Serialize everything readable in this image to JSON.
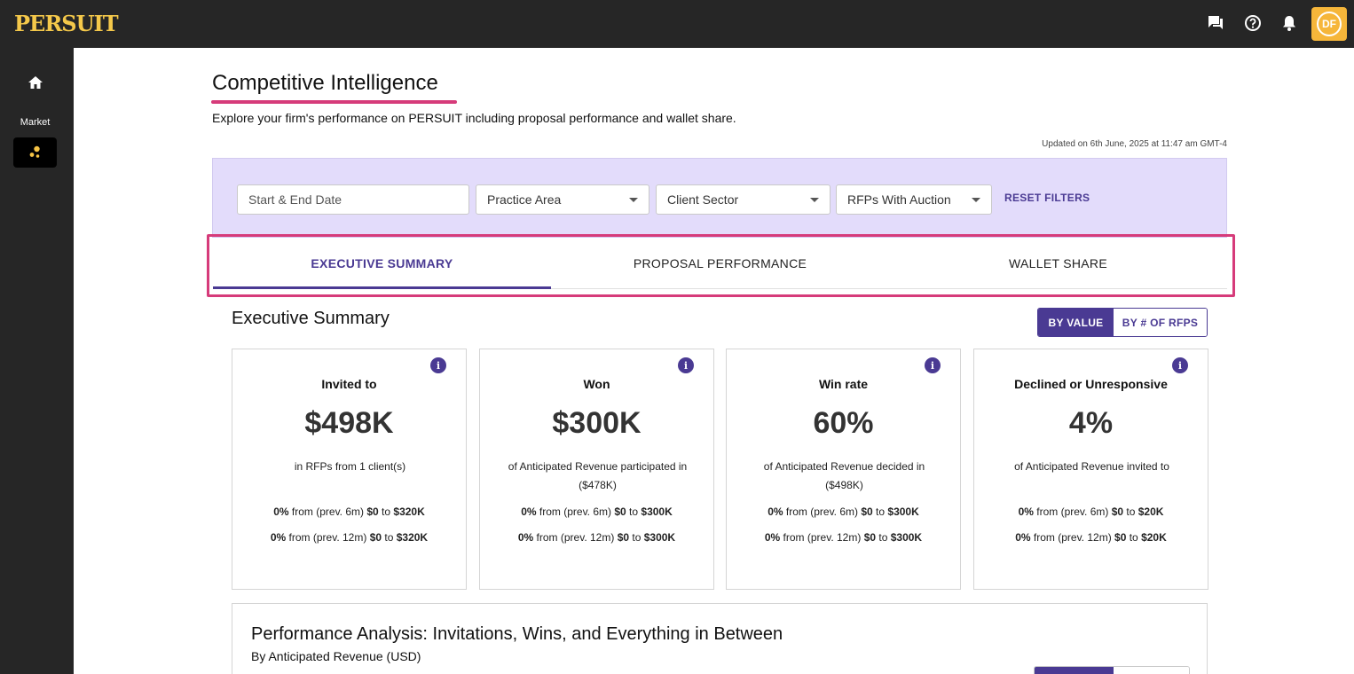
{
  "app": {
    "logo": "PERSUIT",
    "avatar_initials": "DF",
    "accent_color": "#4a3a93",
    "highlight_color": "#d63b7a",
    "brand_color": "#f4c84a"
  },
  "header_icons": [
    "chat-icon",
    "help-icon",
    "bell-icon"
  ],
  "sidebar": {
    "home_icon": "home-icon",
    "market_label": "Market",
    "market_icon": "market-dots-icon"
  },
  "page": {
    "title": "Competitive Intelligence",
    "subtitle": "Explore your firm's performance on PERSUIT including proposal performance and wallet share.",
    "updated": "Updated on 6th June, 2025 at 11:47 am GMT-4"
  },
  "filters": {
    "date_placeholder": "Start & End Date",
    "practice_area": "Practice Area",
    "client_sector": "Client Sector",
    "rfps_auction": "RFPs With Auction",
    "reset": "RESET FILTERS"
  },
  "tabs": [
    {
      "label": "EXECUTIVE SUMMARY",
      "active": true
    },
    {
      "label": "PROPOSAL PERFORMANCE",
      "active": false
    },
    {
      "label": "WALLET SHARE",
      "active": false
    }
  ],
  "summary": {
    "title": "Executive Summary",
    "toggle_value": "BY VALUE",
    "toggle_count": "BY # OF RFPS",
    "cards": [
      {
        "label": "Invited to",
        "value": "$498K",
        "desc": "in RFPs from 1 client(s)",
        "l1_pct": "0%",
        "l1_from": " from (prev. 6m) ",
        "l1_a": "$0",
        "l1_to": " to ",
        "l1_b": "$320K",
        "l2_pct": "0%",
        "l2_from": " from (prev. 12m) ",
        "l2_a": "$0",
        "l2_to": " to ",
        "l2_b": "$320K"
      },
      {
        "label": "Won",
        "value": "$300K",
        "desc": "of Anticipated Revenue participated in ($478K)",
        "l1_pct": "0%",
        "l1_from": " from (prev. 6m) ",
        "l1_a": "$0",
        "l1_to": " to ",
        "l1_b": "$300K",
        "l2_pct": "0%",
        "l2_from": " from (prev. 12m) ",
        "l2_a": "$0",
        "l2_to": " to ",
        "l2_b": "$300K"
      },
      {
        "label": "Win rate",
        "value": "60%",
        "desc": "of Anticipated Revenue decided in ($498K)",
        "l1_pct": "0%",
        "l1_from": " from (prev. 6m) ",
        "l1_a": "$0",
        "l1_to": " to ",
        "l1_b": "$300K",
        "l2_pct": "0%",
        "l2_from": " from (prev. 12m) ",
        "l2_a": "$0",
        "l2_to": " to ",
        "l2_b": "$300K"
      },
      {
        "label": "Declined or Unresponsive",
        "value": "4%",
        "desc": "of Anticipated Revenue invited to",
        "l1_pct": "0%",
        "l1_from": " from (prev. 6m) ",
        "l1_a": "$0",
        "l1_to": " to ",
        "l1_b": "$20K",
        "l2_pct": "0%",
        "l2_from": " from (prev. 12m) ",
        "l2_a": "$0",
        "l2_to": " to ",
        "l2_b": "$20K"
      }
    ]
  },
  "performance": {
    "title": "Performance Analysis: Invitations, Wins, and Everything in Between",
    "subtitle": "By Anticipated Revenue (USD)"
  }
}
